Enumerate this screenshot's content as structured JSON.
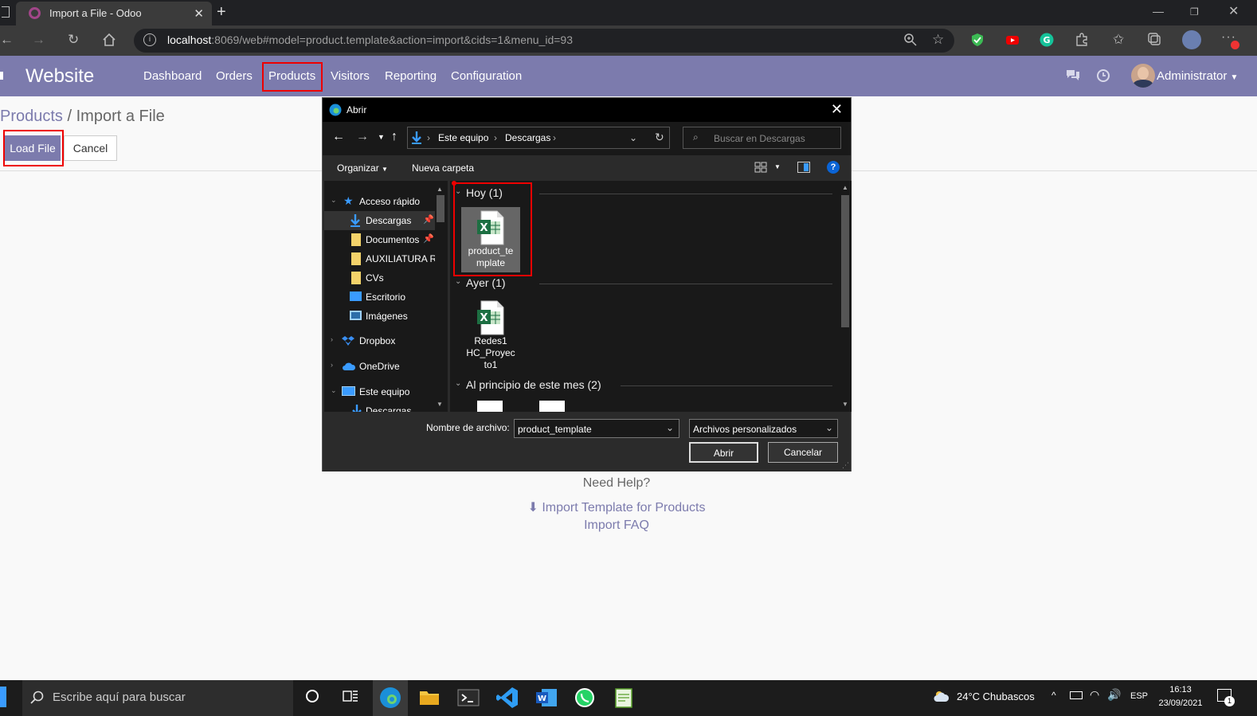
{
  "browser": {
    "tab_title": "Import a File - Odoo",
    "url_host": "localhost",
    "url_rest": ":8069/web#model=product.template&action=import&cids=1&menu_id=93"
  },
  "odoo": {
    "app_name": "Website",
    "menu": [
      "Dashboard",
      "Orders",
      "Products",
      "Visitors",
      "Reporting",
      "Configuration"
    ],
    "user": "Administrator"
  },
  "page": {
    "breadcrumb_parent": "Products",
    "breadcrumb_sep": "/",
    "breadcrumb_current": "Import a File",
    "load_file": "Load File",
    "cancel": "Cancel",
    "need_help": "Need Help?",
    "import_template": "Import Template for Products",
    "import_faq": "Import FAQ"
  },
  "dialog": {
    "title": "Abrir",
    "path": [
      "Este equipo",
      "Descargas"
    ],
    "search_placeholder": "Buscar en Descargas",
    "organize": "Organizar",
    "new_folder": "Nueva carpeta",
    "sidebar": [
      {
        "label": "Acceso rápido"
      },
      {
        "label": "Descargas"
      },
      {
        "label": "Documentos"
      },
      {
        "label": "AUXILIATURA RE"
      },
      {
        "label": "CVs"
      },
      {
        "label": "Escritorio"
      },
      {
        "label": "Imágenes"
      },
      {
        "label": "Dropbox"
      },
      {
        "label": "OneDrive"
      },
      {
        "label": "Este equipo"
      },
      {
        "label": "Descargas"
      }
    ],
    "groups": {
      "hoy": "Hoy (1)",
      "ayer": "Ayer (1)",
      "mes": "Al principio de este mes (2)"
    },
    "files": {
      "hoy_file_line1": "product_te",
      "hoy_file_line2": "mplate",
      "ayer_file_line1": "Redes1",
      "ayer_file_line2": "HC_Proyec",
      "ayer_file_line3": "to1"
    },
    "filename_label": "Nombre de archivo:",
    "filename_value": "product_template",
    "filetype_value": "Archivos personalizados",
    "open_btn": "Abrir",
    "cancel_btn": "Cancelar"
  },
  "taskbar": {
    "search_placeholder": "Escribe aquí para buscar",
    "weather": "24°C  Chubascos",
    "lang": "ESP",
    "time": "16:13",
    "date": "23/09/2021",
    "notifications": "1"
  },
  "colors": {
    "odoo_primary": "#7c7bad",
    "highlight": "#e00000",
    "excel_green": "#1d6f42"
  }
}
